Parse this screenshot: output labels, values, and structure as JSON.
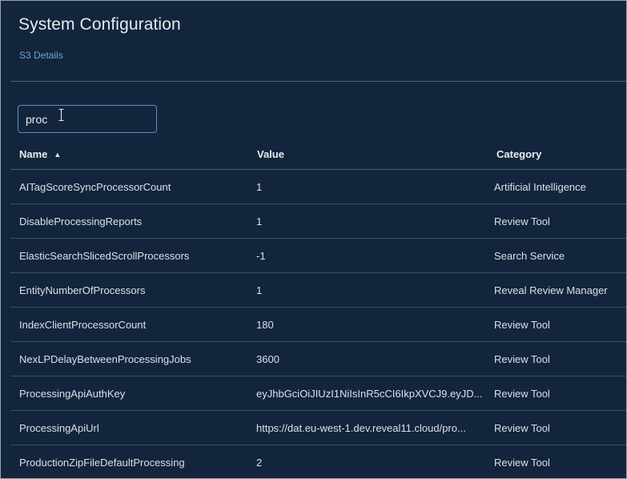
{
  "header": {
    "title": "System Configuration",
    "breadcrumb": "S3 Details"
  },
  "search": {
    "value": "proc",
    "cursor_icon": "text-cursor-icon"
  },
  "table": {
    "columns": {
      "name": "Name",
      "value": "Value",
      "category": "Category"
    },
    "sort": {
      "column": "Name",
      "direction": "ascending",
      "icon": "sort-up-icon"
    },
    "rows": [
      {
        "name": "AITagScoreSyncProcessorCount",
        "value": "1",
        "category": "Artificial Intelligence"
      },
      {
        "name": "DisableProcessingReports",
        "value": "1",
        "category": "Review Tool"
      },
      {
        "name": "ElasticSearchSlicedScrollProcessors",
        "value": "-1",
        "category": "Search Service"
      },
      {
        "name": "EntityNumberOfProcessors",
        "value": "1",
        "category": "Reveal Review Manager"
      },
      {
        "name": "IndexClientProcessorCount",
        "value": "180",
        "category": "Review Tool"
      },
      {
        "name": "NexLPDelayBetweenProcessingJobs",
        "value": "3600",
        "category": "Review Tool"
      },
      {
        "name": "ProcessingApiAuthKey",
        "value": "eyJhbGciOiJIUzI1NiIsInR5cCI6IkpXVCJ9.eyJD...",
        "category": "Review Tool"
      },
      {
        "name": "ProcessingApiUrl",
        "value": "https://dat.eu-west-1.dev.reveal11.cloud/pro...",
        "category": "Review Tool"
      },
      {
        "name": "ProductionZipFileDefaultProcessing",
        "value": "2",
        "category": "Review Tool"
      }
    ]
  },
  "colors": {
    "background": "#13253c",
    "accent": "#6fa3d8",
    "search_border": "#5e8fbe",
    "row_divider": "#3d4e62"
  }
}
